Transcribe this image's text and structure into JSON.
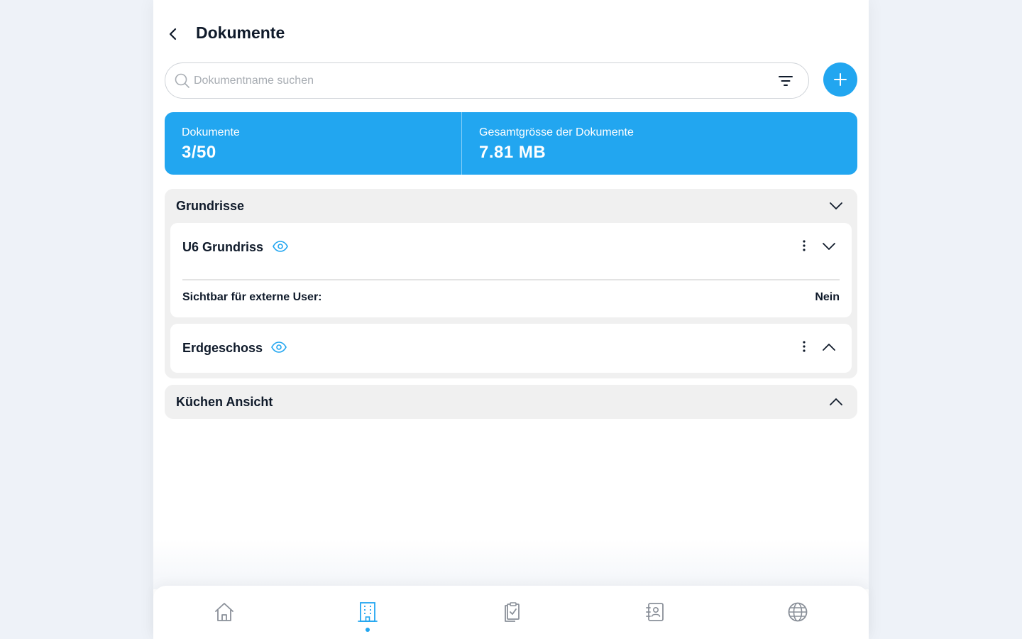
{
  "header": {
    "back_icon": "chevron-left-icon",
    "title": "Dokumente"
  },
  "search": {
    "placeholder": "Dokumentname suchen",
    "value": "",
    "search_icon": "search-icon",
    "filter_icon": "filter-icon"
  },
  "add_button": {
    "icon": "plus-icon",
    "color": "#22a6f0"
  },
  "stats": {
    "documents_label": "Dokumente",
    "documents_value": "3/50",
    "size_label": "Gesamtgrösse der Dokumente",
    "size_value": "7.81 MB",
    "color": "#22a6f0"
  },
  "groups": [
    {
      "title": "Grundrisse",
      "expanded": true,
      "documents": [
        {
          "name": "U6 Grundriss",
          "expanded": true,
          "visibility_label": "Sichtbar für externe User:",
          "visibility_value": "Nein"
        },
        {
          "name": "Erdgeschoss",
          "expanded": false
        }
      ]
    },
    {
      "title": "Küchen Ansicht",
      "expanded": false
    }
  ],
  "bottom_nav": {
    "items": [
      {
        "icon": "home-icon",
        "active": false
      },
      {
        "icon": "building-icon",
        "active": true
      },
      {
        "icon": "clipboard-check-icon",
        "active": false
      },
      {
        "icon": "contacts-book-icon",
        "active": false
      },
      {
        "icon": "globe-icon",
        "active": false
      }
    ],
    "active_color": "#22a6f0",
    "inactive_color": "#8a9099"
  }
}
